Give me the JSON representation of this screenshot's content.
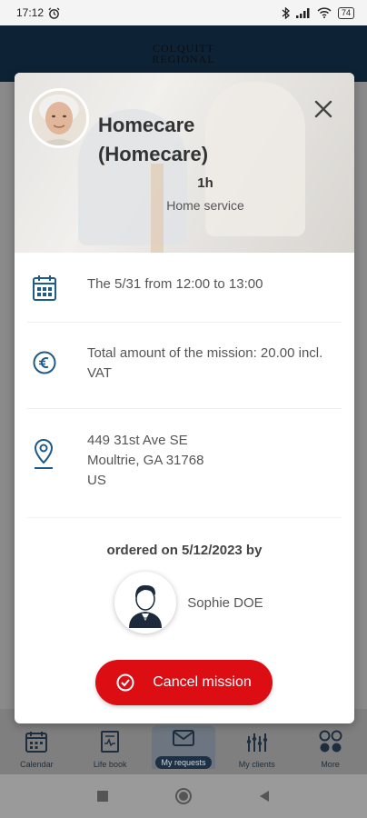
{
  "status_bar": {
    "time": "17:12",
    "battery": "74",
    "icons": [
      "alarm-icon",
      "bluetooth-icon",
      "signal-icon",
      "wifi-icon",
      "battery-icon"
    ]
  },
  "app": {
    "logo_line1": "COLQUITT",
    "logo_line2": "REGIONAL"
  },
  "bottom_nav": {
    "items": [
      {
        "label": "Calendar",
        "icon": "calendar-icon"
      },
      {
        "label": "Life book",
        "icon": "book-icon"
      },
      {
        "label": "My requests",
        "icon": "envelope-icon"
      },
      {
        "label": "My clients",
        "icon": "clients-icon"
      },
      {
        "label": "More",
        "icon": "more-icon"
      }
    ]
  },
  "modal": {
    "title": "Homecare (Homecare)",
    "duration": "1h",
    "service_type": "Home service",
    "date_text": "The 5/31 from 12:00 to 13:00",
    "amount_text": "Total amount of the mission: 20.00 incl. VAT",
    "address_line1": "449 31st Ave SE",
    "address_line2": "Moultrie, GA 31768",
    "address_line3": "US",
    "ordered_text": "ordered on 5/12/2023 by",
    "orderer_name": "Sophie DOE",
    "cancel_label": "Cancel mission"
  },
  "colors": {
    "accent": "#dd0d14",
    "icon_blue": "#1e5a8a",
    "header_navy": "#0e2236"
  }
}
